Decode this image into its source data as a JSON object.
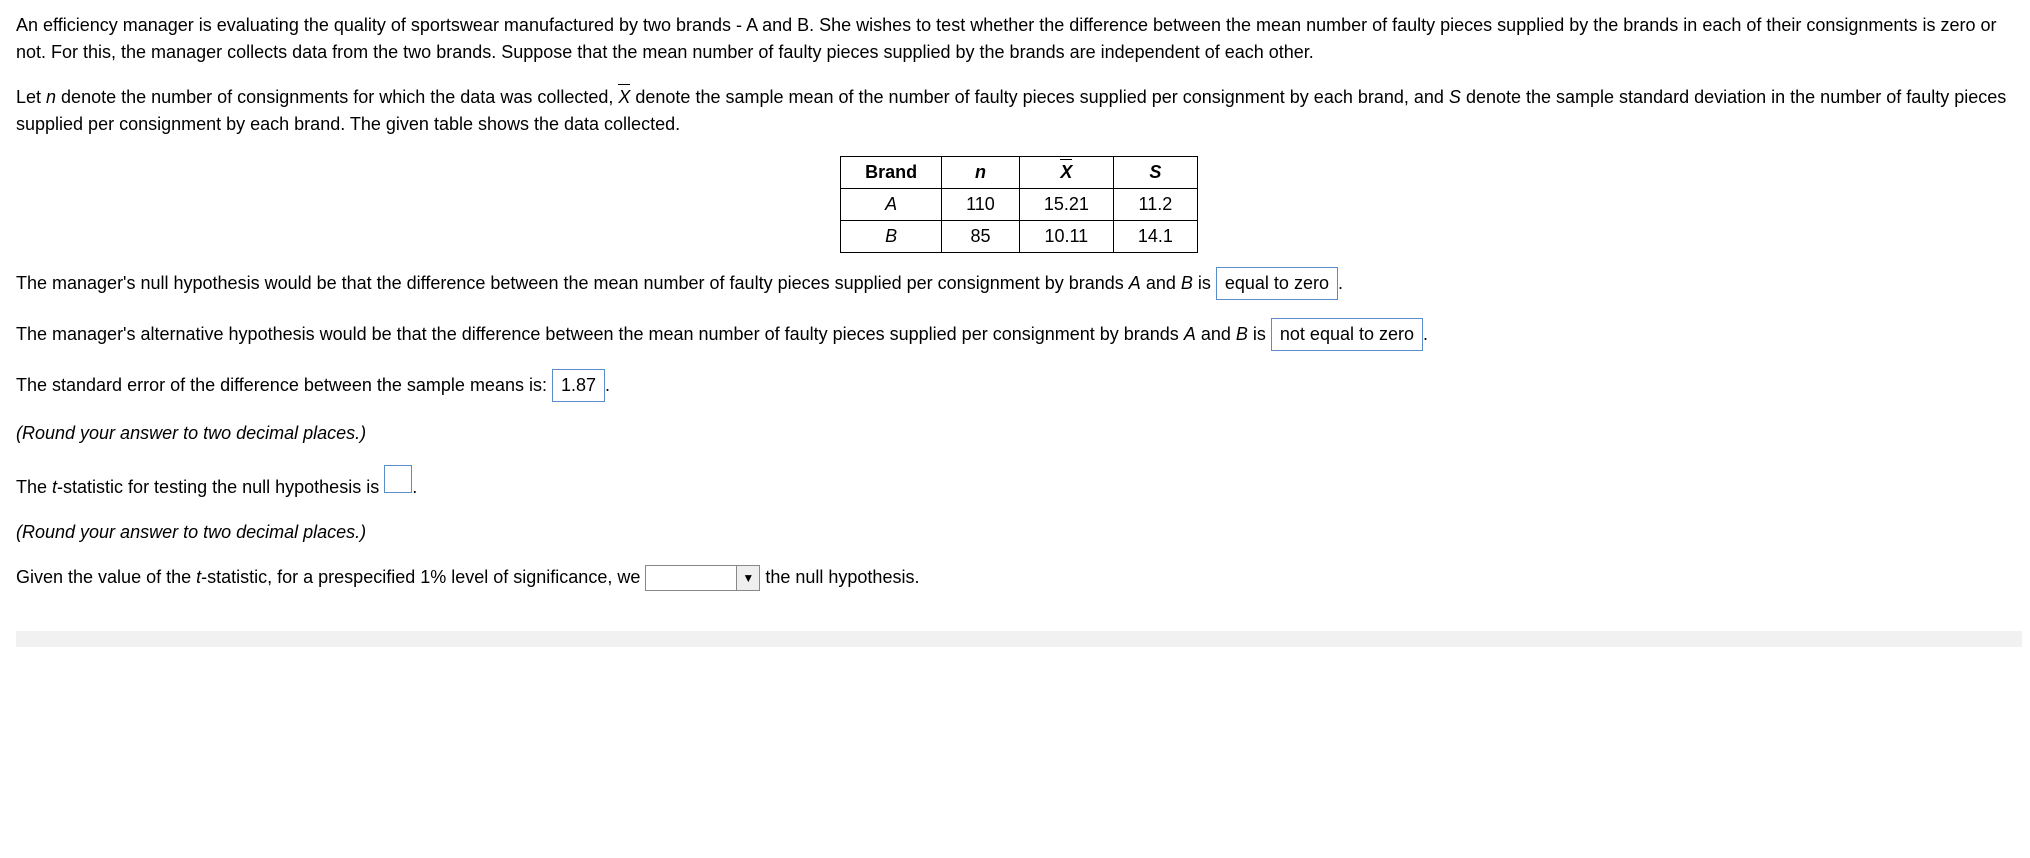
{
  "intro": {
    "p1": "An efficiency manager is evaluating the quality of sportswear manufactured by two brands - A and B. She wishes to test whether the difference between the mean number of faulty pieces supplied by the brands in each of their consignments is zero or not. For this, the manager collects data from the two brands. Suppose that the mean number of faulty pieces supplied by the brands are independent of each other.",
    "p2a": "Let ",
    "p2_n": "n",
    "p2b": " denote the number of consignments for which the data was collected, ",
    "p2_x": "X",
    "p2c": " denote the sample mean of the number of faulty pieces supplied per consignment by each brand, and ",
    "p2_s": "S",
    "p2d": " denote the sample standard deviation in the number of faulty pieces supplied per consignment by each brand. The given table shows the data collected."
  },
  "table": {
    "h_brand": "Brand",
    "h_n": "n",
    "h_x": "X",
    "h_s": "S",
    "rows": [
      {
        "brand": "A",
        "n": "110",
        "x": "15.21",
        "s": "11.2"
      },
      {
        "brand": "B",
        "n": "85",
        "x": "10.11",
        "s": "14.1"
      }
    ]
  },
  "q_null": {
    "pre": "The manager's null hypothesis would be that the difference between the mean number of faulty pieces supplied per consignment by brands ",
    "a": "A",
    "and": " and ",
    "b": "B",
    "mid": " is ",
    "answer": "equal to zero",
    "post": "."
  },
  "q_alt": {
    "pre": "The manager's alternative hypothesis would be that the difference between the mean number of faulty pieces supplied per consignment by brands ",
    "a": "A",
    "and": " and ",
    "b": "B",
    "mid": " is ",
    "answer": "not equal to zero",
    "post": "."
  },
  "q_se": {
    "pre": "The standard error of the difference between the sample means is: ",
    "answer": "1.87",
    "post": "."
  },
  "round_note": "(Round your answer to two decimal places.)",
  "q_t": {
    "pre": "The ",
    "t": "t",
    "mid": "-statistic for testing the null hypothesis is ",
    "answer": "",
    "post": "."
  },
  "q_conc": {
    "pre1": "Given the value of the ",
    "t": "t",
    "pre2": "-statistic, for a prespecified 1% level of significance, we ",
    "dropdown_value": "",
    "arrow": "▼",
    "post": " the null hypothesis."
  }
}
